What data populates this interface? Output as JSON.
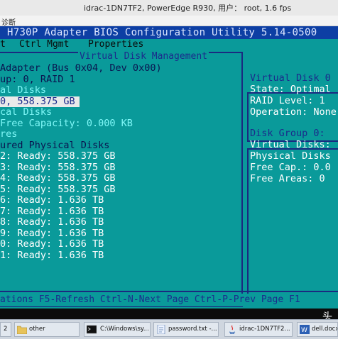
{
  "window": {
    "title": "idrac-1DN7TF2, PowerEdge R930, 用户： root, 1.6 fps",
    "menu_left": "诊断"
  },
  "bios": {
    "header": "H730P Adapter BIOS Configuration Utility 5.14-0500",
    "menu": [
      "t",
      "Ctrl Mgmt",
      "Properties"
    ],
    "panel_title": "Virtual Disk Management",
    "left_lines": [
      "Adapter (Bus 0x04, Dev 0x00)",
      "up: 0, RAID 1",
      "al Disks",
      "0, 558.375 GB",
      "cal Disks",
      " Free Capacity: 0.000 KB",
      "res",
      "ured Physical Disks",
      "2: Ready: 558.375 GB",
      "3: Ready: 558.375 GB",
      "4: Ready: 558.375 GB",
      "5: Ready: 558.375 GB",
      "6: Ready: 1.636 TB",
      "7: Ready: 1.636 TB",
      "8: Ready: 1.636 TB",
      "9: Ready: 1.636 TB",
      "0: Ready: 1.636 TB",
      "1: Ready: 1.636 TB"
    ],
    "right_top": {
      "title": "Virtual Disk 0",
      "lines": [
        "State: Optimal",
        "RAID Level: 1",
        "Operation: None"
      ]
    },
    "right_bottom": {
      "title": "Disk Group 0:",
      "lines": [
        "Virtual Disks:",
        "Physical Disks",
        "Free Cap.: 0.0",
        "Free Areas: 0"
      ]
    },
    "footer": "ations F5-Refresh Ctrl-N-Next Page Ctrl-P-Prev Page F1"
  },
  "watermark": "头",
  "taskbar": {
    "items": [
      {
        "label": "2",
        "icon": "app-icon"
      },
      {
        "label": "other",
        "icon": "folder-icon"
      },
      {
        "label": "C:\\Windows\\sy...",
        "icon": "cmd-icon"
      },
      {
        "label": "password.txt -...",
        "icon": "notepad-icon"
      },
      {
        "label": "idrac-1DN7TF2...",
        "icon": "java-icon"
      },
      {
        "label": "dell.docx",
        "icon": "word-icon"
      }
    ]
  },
  "colors": {
    "screen_bg": "#0a9a9a",
    "header_bg": "#0d3fa4",
    "text_dark": "#0a1450",
    "text_cyan": "#7ff7f7",
    "text_blue": "#1b2c8c"
  }
}
